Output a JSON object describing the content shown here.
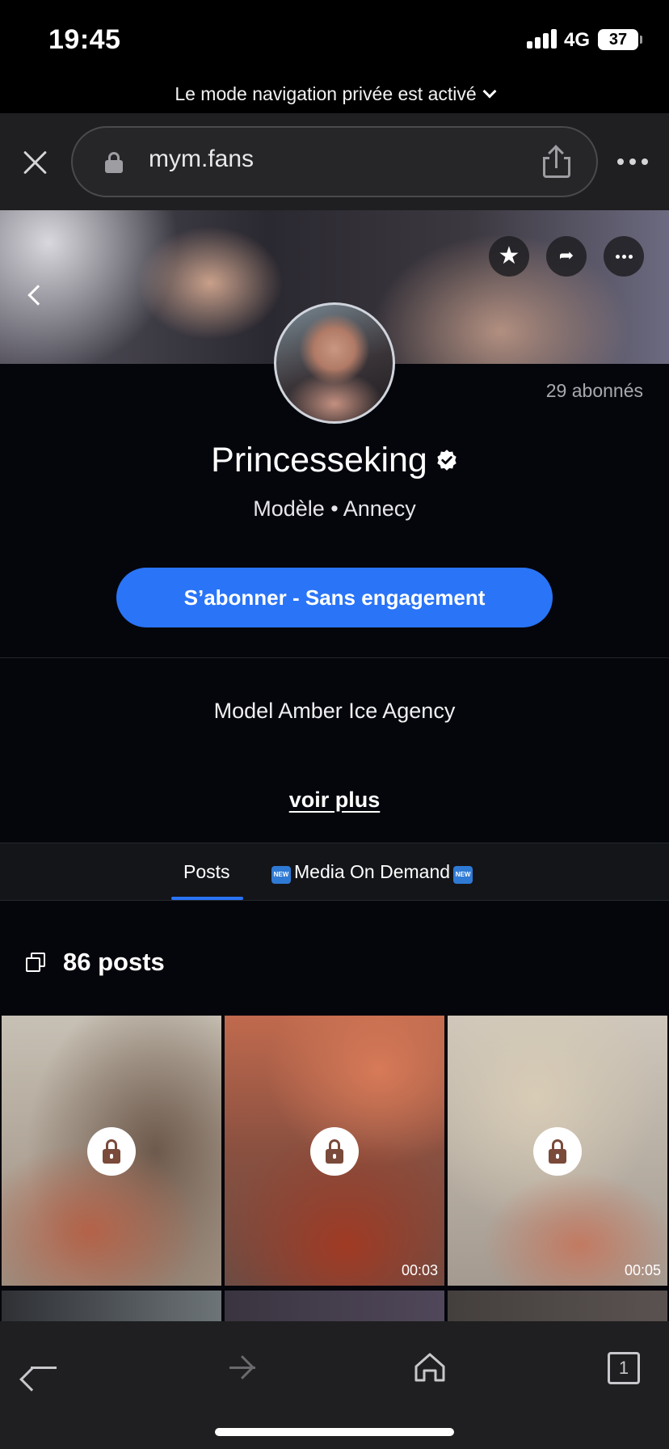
{
  "status_bar": {
    "time": "19:45",
    "network": "4G",
    "battery": "37"
  },
  "private_banner": {
    "text": "Le mode navigation privée est activé"
  },
  "browser": {
    "url": "mym.fans"
  },
  "profile": {
    "followers": "29 abonnés",
    "name": "Princesseking",
    "subtitle": "Modèle • Annecy",
    "subscribe_label": "S’abonner - Sans engagement",
    "bio": "Model Amber Ice Agency",
    "see_more": "voir plus"
  },
  "tabs": [
    {
      "label": "Posts",
      "active": true
    },
    {
      "label": "Media On Demand",
      "active": false,
      "badges": [
        "NEW",
        "NEW"
      ]
    }
  ],
  "posts": {
    "count_label": "86 posts",
    "items": [
      {
        "locked": true,
        "duration": ""
      },
      {
        "locked": true,
        "duration": "00:03"
      },
      {
        "locked": true,
        "duration": "00:05"
      }
    ]
  },
  "toolbar": {
    "tabs_count": "1"
  },
  "colors": {
    "accent": "#2a74f7",
    "background": "#05060c",
    "chrome": "#1f1f21"
  },
  "icons": [
    "close-icon",
    "lock-icon",
    "share-icon",
    "more-icon",
    "back-icon",
    "star-icon",
    "forward-share-icon",
    "verified-icon",
    "stack-icon",
    "home-icon",
    "tabs-icon"
  ]
}
